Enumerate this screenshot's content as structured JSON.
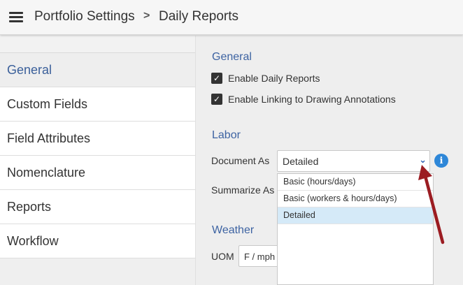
{
  "header": {
    "breadcrumb_parent": "Portfolio Settings",
    "breadcrumb_separator": ">",
    "breadcrumb_current": "Daily Reports"
  },
  "sidebar": {
    "items": [
      {
        "label": "General",
        "active": true
      },
      {
        "label": "Custom Fields",
        "active": false
      },
      {
        "label": "Field Attributes",
        "active": false
      },
      {
        "label": "Nomenclature",
        "active": false
      },
      {
        "label": "Reports",
        "active": false
      },
      {
        "label": "Workflow",
        "active": false
      }
    ]
  },
  "general": {
    "title": "General",
    "enable_daily_reports": {
      "label": "Enable Daily Reports",
      "checked": true
    },
    "enable_linking": {
      "label": "Enable Linking to Drawing Annotations",
      "checked": true
    }
  },
  "labor": {
    "title": "Labor",
    "document_as_label": "Document As",
    "document_as_value": "Detailed",
    "summarize_as_label": "Summarize As",
    "options": [
      "Basic (hours/days)",
      "Basic (workers & hours/days)",
      "Detailed"
    ],
    "selected_option": "Detailed"
  },
  "weather": {
    "title": "Weather",
    "uom_label": "UOM",
    "uom_value": "F / mph"
  },
  "icons": {
    "menu": "hamburger-menu-icon",
    "chevron": "chevron-down-icon",
    "info": "info-icon",
    "check": "check-icon"
  },
  "colors": {
    "accent": "#3d63a2",
    "info": "#2e87d8",
    "selected_option": "#d5eaf8",
    "annotation_arrow": "#9b1c22"
  }
}
